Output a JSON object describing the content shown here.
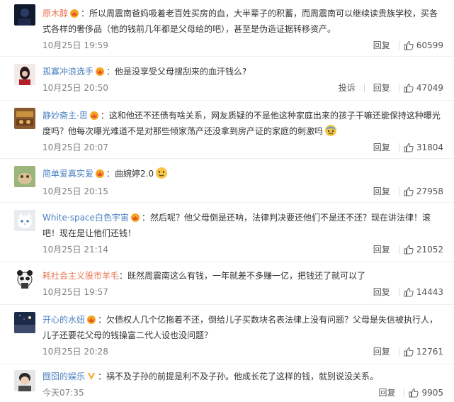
{
  "labels": {
    "reply": "回复",
    "report": "投诉"
  },
  "comments": [
    {
      "user": "原木醇",
      "colon": "：",
      "text": "所以周震南爸妈吸着老百姓买房的血，大半辈子的积蓄，而周震南可以继续读贵族学校，买各式各样的奢侈品（他的钱前几年都是父母给的吧），甚至是伪造证据转移资产。",
      "time": "10月25日 19:59",
      "likes": "60599"
    },
    {
      "user": "孤寡冲浪选手",
      "colon": "：",
      "text": "他是没享受父母搜刮来的血汗钱么?",
      "time": "10月25日 20:50",
      "likes": "47049"
    },
    {
      "user": "静妙斋主·思",
      "colon": "：",
      "text": "这和他还不还债有啥关系，网友质疑的不是他这种家庭出来的孩子干嘛还能保持这种曝光度吗？他每次曝光难道不是对那些倾家荡产还没拿到房产证的家庭的刺激吗",
      "time": "10月25日 20:07",
      "likes": "31804"
    },
    {
      "user": "简单爱真实爱",
      "colon": "：",
      "text": "曲婉婷2.0",
      "time": "10月25日 20:15",
      "likes": "27958"
    },
    {
      "user": "White·space白色宇宙",
      "colon": "：",
      "text": "然后呢？他父母倒是还呐，法律判决要还他们不是还不还？现在讲法律！滚吧！现在是让他们还钱！",
      "time": "10月25日 21:14",
      "likes": "21052"
    },
    {
      "user": "耗社会主义股市羊毛",
      "colon": "：",
      "text": "既然周震南这么有钱，一年就差不多赚一亿，把钱还了就可以了",
      "time": "10月25日 19:57",
      "likes": "14443"
    },
    {
      "user": "开心的水妞",
      "colon": "：",
      "text": "欠债权人几个亿拖着不还，倒给儿子买数块名表法律上没有问题？父母是失信被执行人，儿子还要花父母的钱操富二代人设也没问题？",
      "time": "10月25日 20:28",
      "likes": "12761"
    },
    {
      "user": "囫囵的娱乐",
      "colon": "：",
      "text": "祸不及子孙的前提是利不及子孙。他成长花了这样的钱，就别说没关系。",
      "time": "今天07:35",
      "likes": "9905"
    }
  ]
}
